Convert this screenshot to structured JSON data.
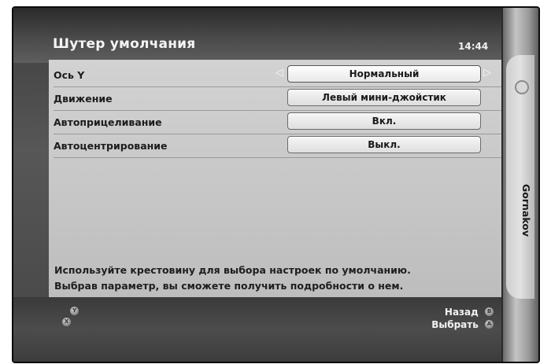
{
  "screen": {
    "title": "Шутер умолчания",
    "clock": "14:44"
  },
  "settings": [
    {
      "label": "Ось Y",
      "value": "Нормальный",
      "selected": true
    },
    {
      "label": "Движение",
      "value": "Левый мини-джойстик",
      "selected": false
    },
    {
      "label": "Автоприцеливание",
      "value": "Вкл.",
      "selected": false
    },
    {
      "label": "Автоцентрирование",
      "value": "Выкл.",
      "selected": false
    }
  ],
  "arrows": {
    "left": "◁",
    "right": "▷"
  },
  "help": {
    "line1": "Используйте крестовину для выбора настроек по умолчанию.",
    "line2": "Выбрав параметр, вы сможете получить подробности о нем."
  },
  "footer": {
    "y_button": "Y",
    "x_button": "X",
    "back_label": "Назад",
    "back_button": "B",
    "select_label": "Выбрать",
    "select_button": "A"
  },
  "blade": {
    "label": "Gornakov"
  }
}
